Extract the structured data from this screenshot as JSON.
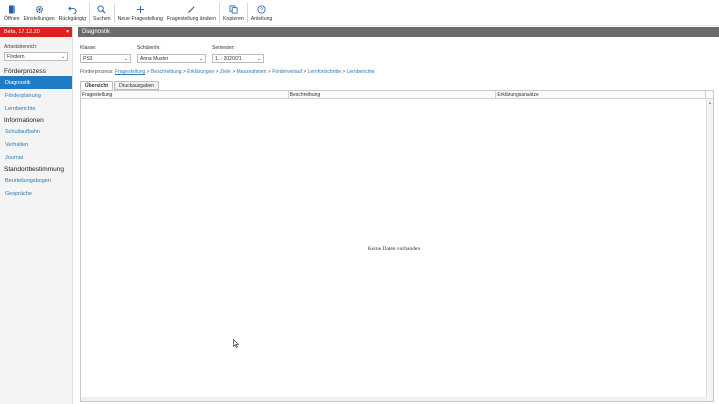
{
  "toolbar": {
    "buttons": [
      {
        "label": "Öffnen",
        "icon": "open-icon"
      },
      {
        "label": "Einstellungen",
        "icon": "gear-icon"
      },
      {
        "label": "Rückgängig",
        "icon": "undo-icon"
      },
      {
        "label": "Suchen",
        "icon": "search-icon"
      },
      {
        "label": "Neue Fragestellung",
        "icon": "plus-icon"
      },
      {
        "label": "Fragestellung ändern",
        "icon": "pencil-icon"
      },
      {
        "label": "Kopieren",
        "icon": "copy-icon"
      },
      {
        "label": "Anleitung",
        "icon": "help-icon"
      }
    ]
  },
  "sidebar": {
    "version": "Beta, 17.12.20",
    "workspace_label": "Arbeitsbereich:",
    "workspace_value": "Fördern",
    "groups": [
      {
        "title": "Förderprozess",
        "items": [
          {
            "label": "Diagnostik",
            "active": true
          },
          {
            "label": "Förderplanung"
          },
          {
            "label": "Lernberichte"
          }
        ]
      },
      {
        "title": "Informationen",
        "items": [
          {
            "label": "Schullaufbahn"
          },
          {
            "label": "Verhalten"
          },
          {
            "label": "Journal"
          }
        ]
      },
      {
        "title": "Standortbestimmung",
        "items": [
          {
            "label": "Beurteilungsbogen"
          },
          {
            "label": "Gespräche"
          }
        ]
      }
    ]
  },
  "header": {
    "title": "Diagnostik"
  },
  "filters": {
    "klasse": {
      "label": "Klasse:",
      "value": "PS3"
    },
    "schueler": {
      "label": "Schüler/in:",
      "value": "Anna Muster"
    },
    "semester": {
      "label": "Semester:",
      "value": "1. - 2020/21"
    }
  },
  "breadcrumb": {
    "label": "Förderprozess:",
    "current": "Fragestellung",
    "items": [
      "Beschreibung",
      "Erklärungen",
      "Ziele",
      "Massnahmen",
      "Förderverlauf",
      "Lernfortschritte",
      "Lernberichte"
    ],
    "separator": ">"
  },
  "tabs": [
    {
      "label": "Übersicht",
      "active": true
    },
    {
      "label": "Druckausgaben"
    }
  ],
  "table": {
    "columns": [
      "Fragestellung",
      "Beschreibung",
      "Erklärungsansätze"
    ],
    "empty_text": "Keine Daten vorhanden"
  },
  "colors": {
    "accent": "#1f7cc4",
    "version_bar": "#e02020",
    "header_bar": "#6b6b6b",
    "link": "#2a7ab8"
  }
}
